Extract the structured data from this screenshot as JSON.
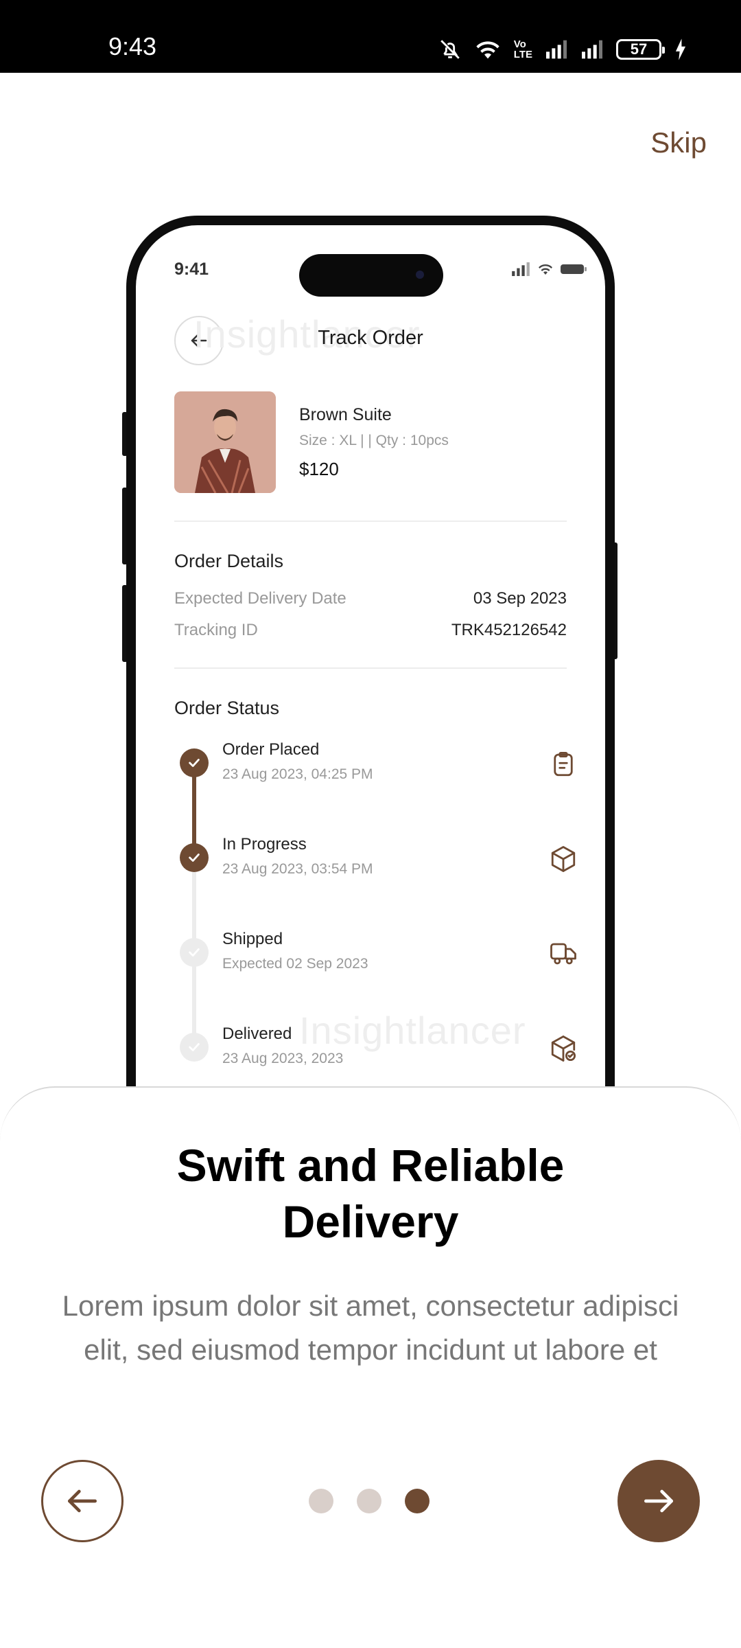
{
  "status_bar": {
    "time": "9:43",
    "battery": "57",
    "icons": [
      "mute-icon",
      "wifi-icon",
      "volte-icon",
      "signal-icon",
      "signal-icon",
      "battery-icon",
      "charging-icon"
    ]
  },
  "skip_label": "Skip",
  "mockup": {
    "status_time": "9:41",
    "header_title": "Track Order",
    "watermark": "Insightlancer",
    "product": {
      "name": "Brown Suite",
      "meta": "Size : XL | | Qty : 10pcs",
      "price": "$120"
    },
    "order_details": {
      "title": "Order Details",
      "rows": [
        {
          "label": "Expected Delivery Date",
          "value": "03 Sep 2023"
        },
        {
          "label": "Tracking ID",
          "value": "TRK452126542"
        }
      ]
    },
    "order_status": {
      "title": "Order Status",
      "steps": [
        {
          "title": "Order Placed",
          "sub": "23 Aug 2023, 04:25 PM",
          "done": true,
          "icon": "clipboard-icon"
        },
        {
          "title": "In Progress",
          "sub": "23 Aug 2023, 03:54 PM",
          "done": true,
          "icon": "box-icon"
        },
        {
          "title": "Shipped",
          "sub": "Expected 02 Sep 2023",
          "done": false,
          "icon": "truck-icon"
        },
        {
          "title": "Delivered",
          "sub": "23 Aug 2023, 2023",
          "done": false,
          "icon": "box-check-icon"
        }
      ]
    }
  },
  "onboarding": {
    "headline_line1": "Swift and Reliable",
    "headline_line2": "Delivery",
    "description_line1": "Lorem ipsum dolor sit amet, consectetur adipisci",
    "description_line2": "elit, sed eiusmod tempor incidunt ut labore et",
    "page_index": 3,
    "page_count": 3
  },
  "colors": {
    "accent": "#6e4a32",
    "dot_inactive": "#d9cfca",
    "text_muted": "#777777"
  }
}
